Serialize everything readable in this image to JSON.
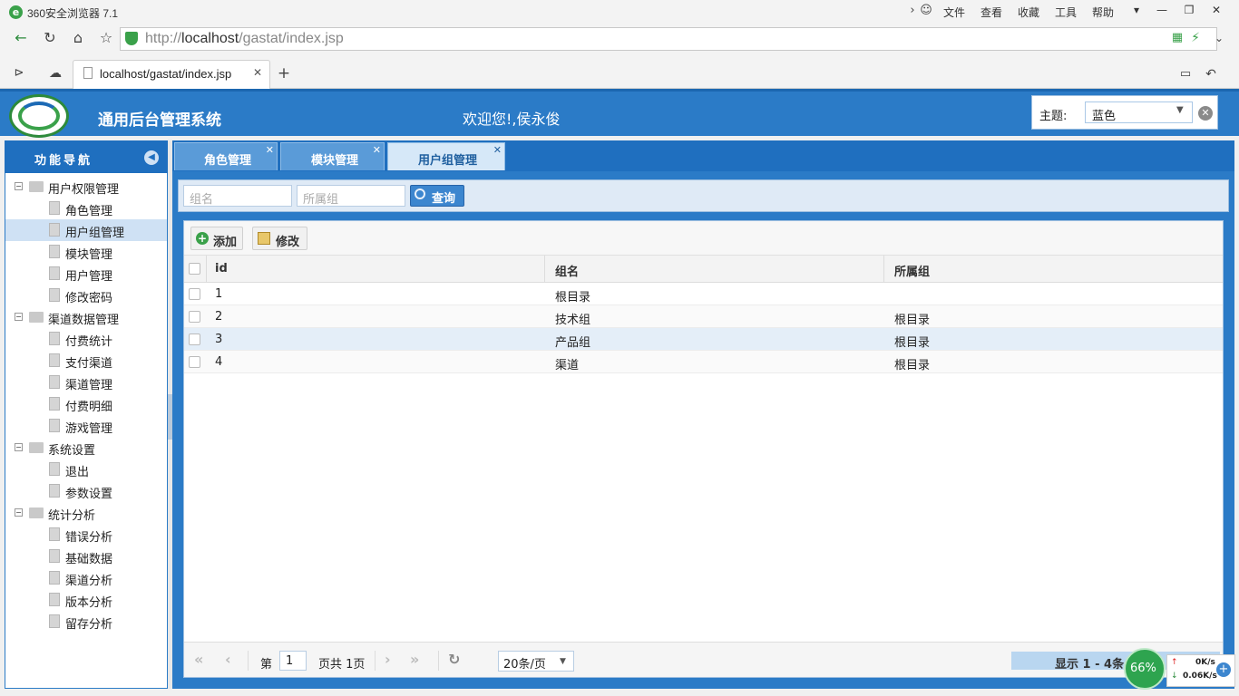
{
  "browser": {
    "title": "360安全浏览器 7.1",
    "menu": [
      "文件",
      "查看",
      "收藏",
      "工具",
      "帮助"
    ],
    "url_prefix": "http://",
    "url_host": "localhost",
    "url_path": "/gastat/index.jsp",
    "tab_title": "localhost/gastat/index.jsp"
  },
  "header": {
    "title": "通用后台管理系统",
    "welcome": "欢迎您!,侯永俊",
    "theme_label": "主题:",
    "theme_value": "蓝色"
  },
  "nav": {
    "title": "功能导航",
    "tree": [
      {
        "label": "用户权限管理",
        "type": "folder"
      },
      {
        "label": "角色管理",
        "type": "file"
      },
      {
        "label": "用户组管理",
        "type": "file",
        "selected": true
      },
      {
        "label": "模块管理",
        "type": "file"
      },
      {
        "label": "用户管理",
        "type": "file"
      },
      {
        "label": "修改密码",
        "type": "file"
      },
      {
        "label": "渠道数据管理",
        "type": "folder"
      },
      {
        "label": "付费统计",
        "type": "file"
      },
      {
        "label": "支付渠道",
        "type": "file"
      },
      {
        "label": "渠道管理",
        "type": "file"
      },
      {
        "label": "付费明细",
        "type": "file"
      },
      {
        "label": "游戏管理",
        "type": "file"
      },
      {
        "label": "系统设置",
        "type": "folder"
      },
      {
        "label": "退出",
        "type": "file"
      },
      {
        "label": "参数设置",
        "type": "file"
      },
      {
        "label": "统计分析",
        "type": "folder"
      },
      {
        "label": "错误分析",
        "type": "file"
      },
      {
        "label": "基础数据",
        "type": "file"
      },
      {
        "label": "渠道分析",
        "type": "file"
      },
      {
        "label": "版本分析",
        "type": "file"
      },
      {
        "label": "留存分析",
        "type": "file"
      }
    ]
  },
  "tabs": [
    {
      "label": "角色管理"
    },
    {
      "label": "模块管理"
    },
    {
      "label": "用户组管理",
      "active": true
    }
  ],
  "search": {
    "group_placeholder": "组名",
    "parent_placeholder": "所属组",
    "button": "查询"
  },
  "toolbar": {
    "add": "添加",
    "edit": "修改"
  },
  "grid": {
    "columns": [
      "id",
      "组名",
      "所属组"
    ],
    "rows": [
      [
        "1",
        "根目录",
        ""
      ],
      [
        "2",
        "技术组",
        "根目录"
      ],
      [
        "3",
        "产品组",
        "根目录"
      ],
      [
        "4",
        "渠道",
        "根目录"
      ]
    ]
  },
  "pager": {
    "page_label": "第",
    "page_value": "1",
    "page_total": "页共 1页",
    "page_size": "20条/页",
    "display": "显示 1 - 4条"
  },
  "speed": {
    "percent": "66%",
    "up": "0K/s",
    "down": "0.06K/s"
  },
  "colors": {
    "accent": "#2b7bc7",
    "nav_head": "#1f6fbf",
    "selected": "#cfe1f4"
  }
}
